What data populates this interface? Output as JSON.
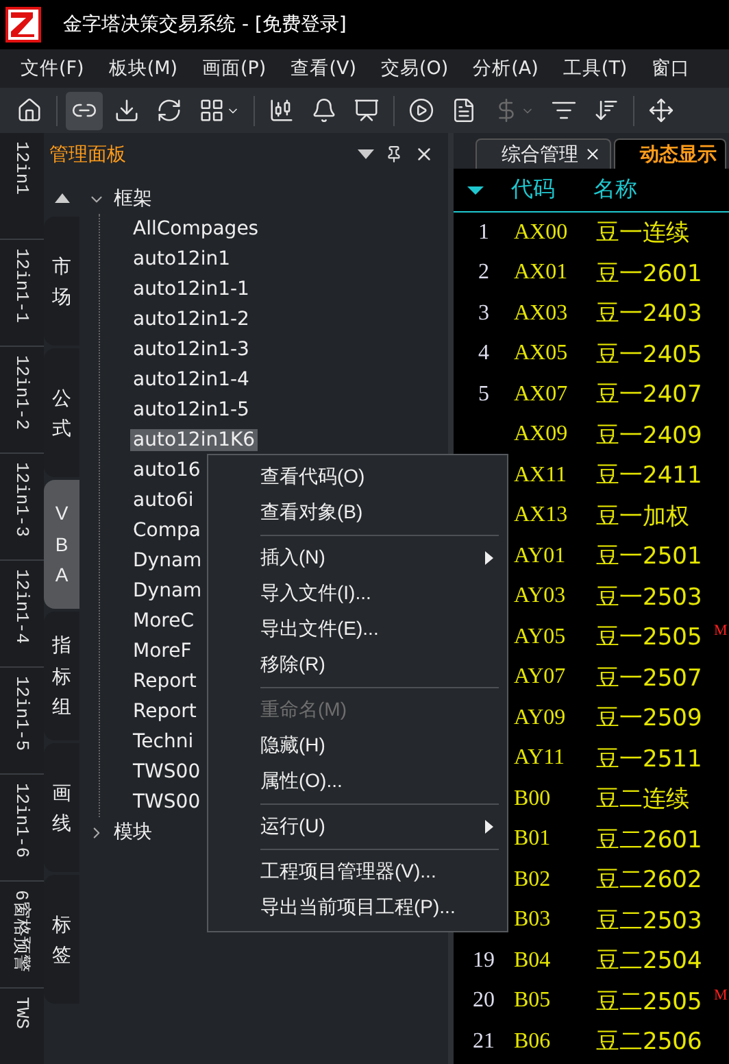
{
  "window": {
    "title": "金字塔决策交易系统 - [免费登录]"
  },
  "menu_bar": [
    "文件(F)",
    "板块(M)",
    "画面(P)",
    "查看(V)",
    "交易(O)",
    "分析(A)",
    "工具(T)",
    "窗口"
  ],
  "toolbar": [
    {
      "kind": "home",
      "selected": false,
      "disabled": false
    },
    {
      "kind": "separator"
    },
    {
      "kind": "link",
      "selected": true,
      "disabled": false
    },
    {
      "kind": "download",
      "selected": false,
      "disabled": false
    },
    {
      "kind": "refresh",
      "selected": false,
      "disabled": false
    },
    {
      "kind": "grid",
      "selected": false,
      "disabled": false
    },
    {
      "kind": "separator"
    },
    {
      "kind": "candles",
      "selected": false,
      "disabled": false
    },
    {
      "kind": "bell",
      "selected": false,
      "disabled": false
    },
    {
      "kind": "chart",
      "selected": false,
      "disabled": false
    },
    {
      "kind": "separator"
    },
    {
      "kind": "play",
      "selected": false,
      "disabled": false
    },
    {
      "kind": "document",
      "selected": false,
      "disabled": false
    },
    {
      "kind": "dollar",
      "selected": false,
      "disabled": true
    },
    {
      "kind": "filter",
      "selected": false,
      "disabled": false
    },
    {
      "kind": "sort",
      "selected": false,
      "disabled": false
    },
    {
      "kind": "separator"
    },
    {
      "kind": "move",
      "selected": false,
      "disabled": false
    }
  ],
  "side_tabs": [
    "12in1",
    "12in1-1",
    "12in1-2",
    "12in1-3",
    "12in1-4",
    "12in1-5",
    "12in1-6",
    "6窗格预警",
    "TWS"
  ],
  "panel": {
    "title": "管理面板",
    "tabs": [
      {
        "label": "市场",
        "selected": false
      },
      {
        "label": "公式",
        "selected": false
      },
      {
        "label": "VBA",
        "selected": true
      },
      {
        "label": "指标组",
        "selected": false
      },
      {
        "label": "画线",
        "selected": false
      },
      {
        "label": "标签",
        "selected": false
      }
    ],
    "tree": [
      {
        "label": "框架",
        "expanded": true,
        "children": [
          {
            "label": "AllCompages",
            "selected": false
          },
          {
            "label": "auto12in1",
            "selected": false
          },
          {
            "label": "auto12in1-1",
            "selected": false
          },
          {
            "label": "auto12in1-2",
            "selected": false
          },
          {
            "label": "auto12in1-3",
            "selected": false
          },
          {
            "label": "auto12in1-4",
            "selected": false
          },
          {
            "label": "auto12in1-5",
            "selected": false
          },
          {
            "label": "auto12in1K6",
            "selected": true
          },
          {
            "label": "auto16",
            "selected": false
          },
          {
            "label": "auto6i",
            "selected": false
          },
          {
            "label": "Compa",
            "selected": false
          },
          {
            "label": "Dynam",
            "selected": false
          },
          {
            "label": "Dynam",
            "selected": false
          },
          {
            "label": "MoreC",
            "selected": false
          },
          {
            "label": "MoreF",
            "selected": false
          },
          {
            "label": "Report",
            "selected": false
          },
          {
            "label": "Report",
            "selected": false
          },
          {
            "label": "Techni",
            "selected": false
          },
          {
            "label": "TWS00",
            "selected": false
          },
          {
            "label": "TWS00",
            "selected": false
          }
        ]
      },
      {
        "label": "模块",
        "expanded": false
      }
    ]
  },
  "context_menu": [
    {
      "kind": "item",
      "label": "查看代码(O)",
      "disabled": false,
      "submenu": false
    },
    {
      "kind": "item",
      "label": "查看对象(B)",
      "disabled": false,
      "submenu": false
    },
    {
      "kind": "separator"
    },
    {
      "kind": "item",
      "label": "插入(N)",
      "disabled": false,
      "submenu": true
    },
    {
      "kind": "item",
      "label": "导入文件(I)...",
      "disabled": false,
      "submenu": false
    },
    {
      "kind": "item",
      "label": "导出文件(E)...",
      "disabled": false,
      "submenu": false
    },
    {
      "kind": "item",
      "label": "移除(R)",
      "disabled": false,
      "submenu": false
    },
    {
      "kind": "separator"
    },
    {
      "kind": "item",
      "label": "重命名(M)",
      "disabled": true,
      "submenu": false
    },
    {
      "kind": "item",
      "label": "隐藏(H)",
      "disabled": false,
      "submenu": false
    },
    {
      "kind": "item",
      "label": "属性(O)...",
      "disabled": false,
      "submenu": false
    },
    {
      "kind": "separator"
    },
    {
      "kind": "item",
      "label": "运行(U)",
      "disabled": false,
      "submenu": true
    },
    {
      "kind": "separator"
    },
    {
      "kind": "item",
      "label": "工程项目管理器(V)...",
      "disabled": false,
      "submenu": false
    },
    {
      "kind": "item",
      "label": "导出当前项目工程(P)...",
      "disabled": false,
      "submenu": false
    }
  ],
  "document_tabs": [
    {
      "label": "综合管理",
      "selected": false,
      "closable": true
    },
    {
      "label": "动态显示",
      "selected": true,
      "closable": false
    }
  ],
  "quote_table": {
    "columns": [
      "代码",
      "名称"
    ],
    "rows": [
      {
        "number": "1",
        "code": "AX00",
        "name": "豆一连续"
      },
      {
        "number": "2",
        "code": "AX01",
        "name": "豆一2601"
      },
      {
        "number": "3",
        "code": "AX03",
        "name": "豆一2403"
      },
      {
        "number": "4",
        "code": "AX05",
        "name": "豆一2405"
      },
      {
        "number": "5",
        "code": "AX07",
        "name": "豆一2407"
      },
      {
        "code": "AX09",
        "name": "豆一2409"
      },
      {
        "code": "AX11",
        "name": "豆一2411"
      },
      {
        "code": "AX13",
        "name": "豆一加权"
      },
      {
        "code": "AY01",
        "name": "豆一2501"
      },
      {
        "code": "AY03",
        "name": "豆一2503"
      },
      {
        "code": "AY05",
        "name": "豆一2505",
        "flag": "M"
      },
      {
        "code": "AY07",
        "name": "豆一2507"
      },
      {
        "code": "AY09",
        "name": "豆一2509"
      },
      {
        "code": "AY11",
        "name": "豆一2511"
      },
      {
        "code": "B00",
        "name": "豆二连续"
      },
      {
        "code": "B01",
        "name": "豆二2601"
      },
      {
        "code": "B02",
        "name": "豆二2602"
      },
      {
        "code": "B03",
        "name": "豆二2503"
      },
      {
        "number": "19",
        "code": "B04",
        "name": "豆二2504"
      },
      {
        "number": "20",
        "code": "B05",
        "name": "豆二2505",
        "flag": "M"
      },
      {
        "number": "21",
        "code": "B06",
        "name": "豆二2506"
      }
    ]
  }
}
